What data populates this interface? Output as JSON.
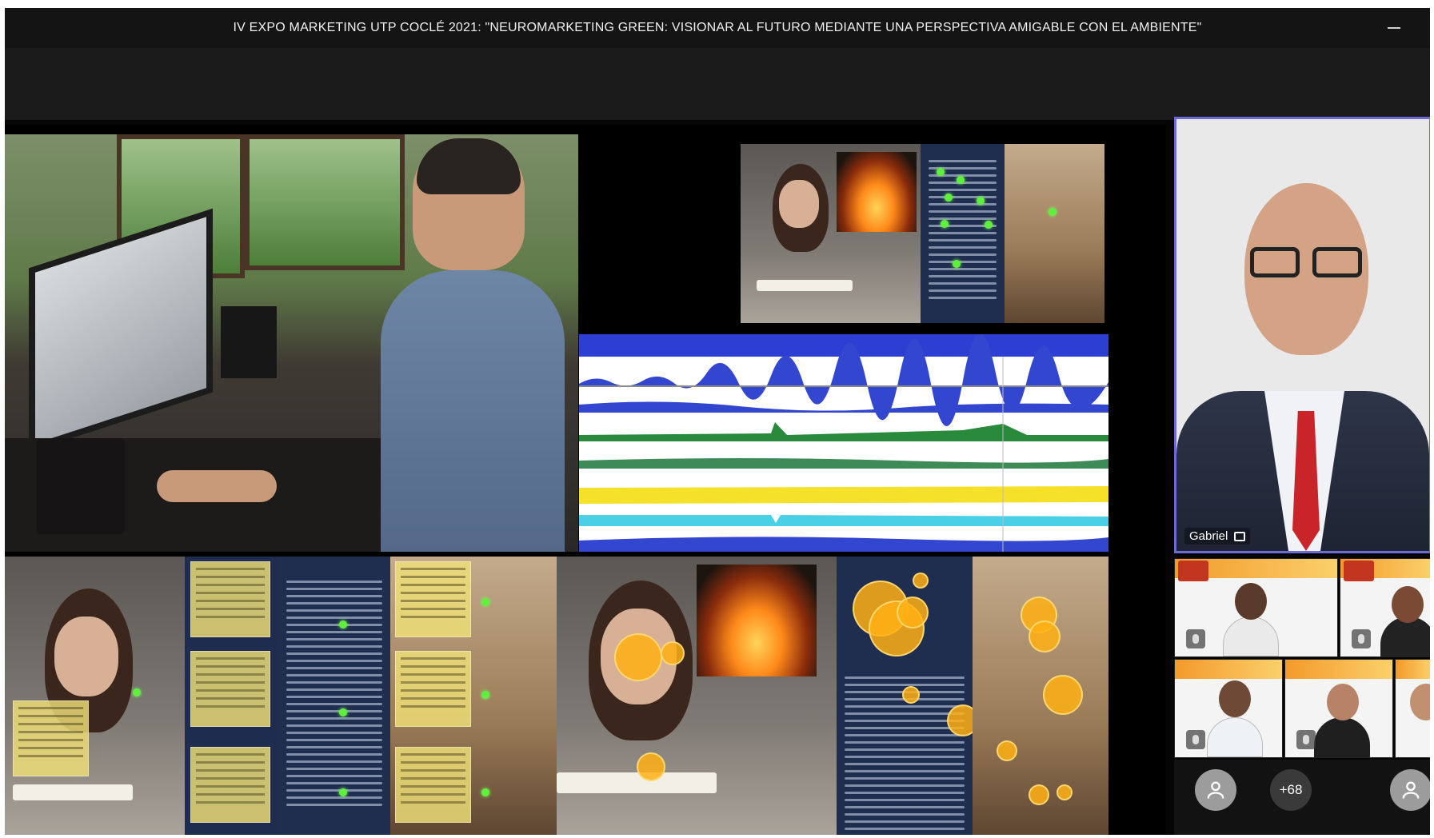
{
  "meeting": {
    "title": "IV EXPO MARKETING UTP COCLÉ 2021: \"NEUROMARKETING GREEN: VISIONAR AL FUTURO MEDIANTE UNA PERSPECTIVA AMIGABLE CON EL AMBIENTE\""
  },
  "presenter": {
    "name": "Gabriel"
  },
  "participants": {
    "overflow_count": "+68"
  },
  "icons": {
    "minimize": "minimize-icon",
    "screen_share": "screen-share-icon",
    "mic_off": "mic-off-icon",
    "avatar": "person-icon"
  },
  "colors": {
    "active_speaker_border": "#6c6bd6",
    "title_bar": "#141414",
    "heatmap_fixation": "#ffb014",
    "gaze_point": "#5ef03c"
  }
}
